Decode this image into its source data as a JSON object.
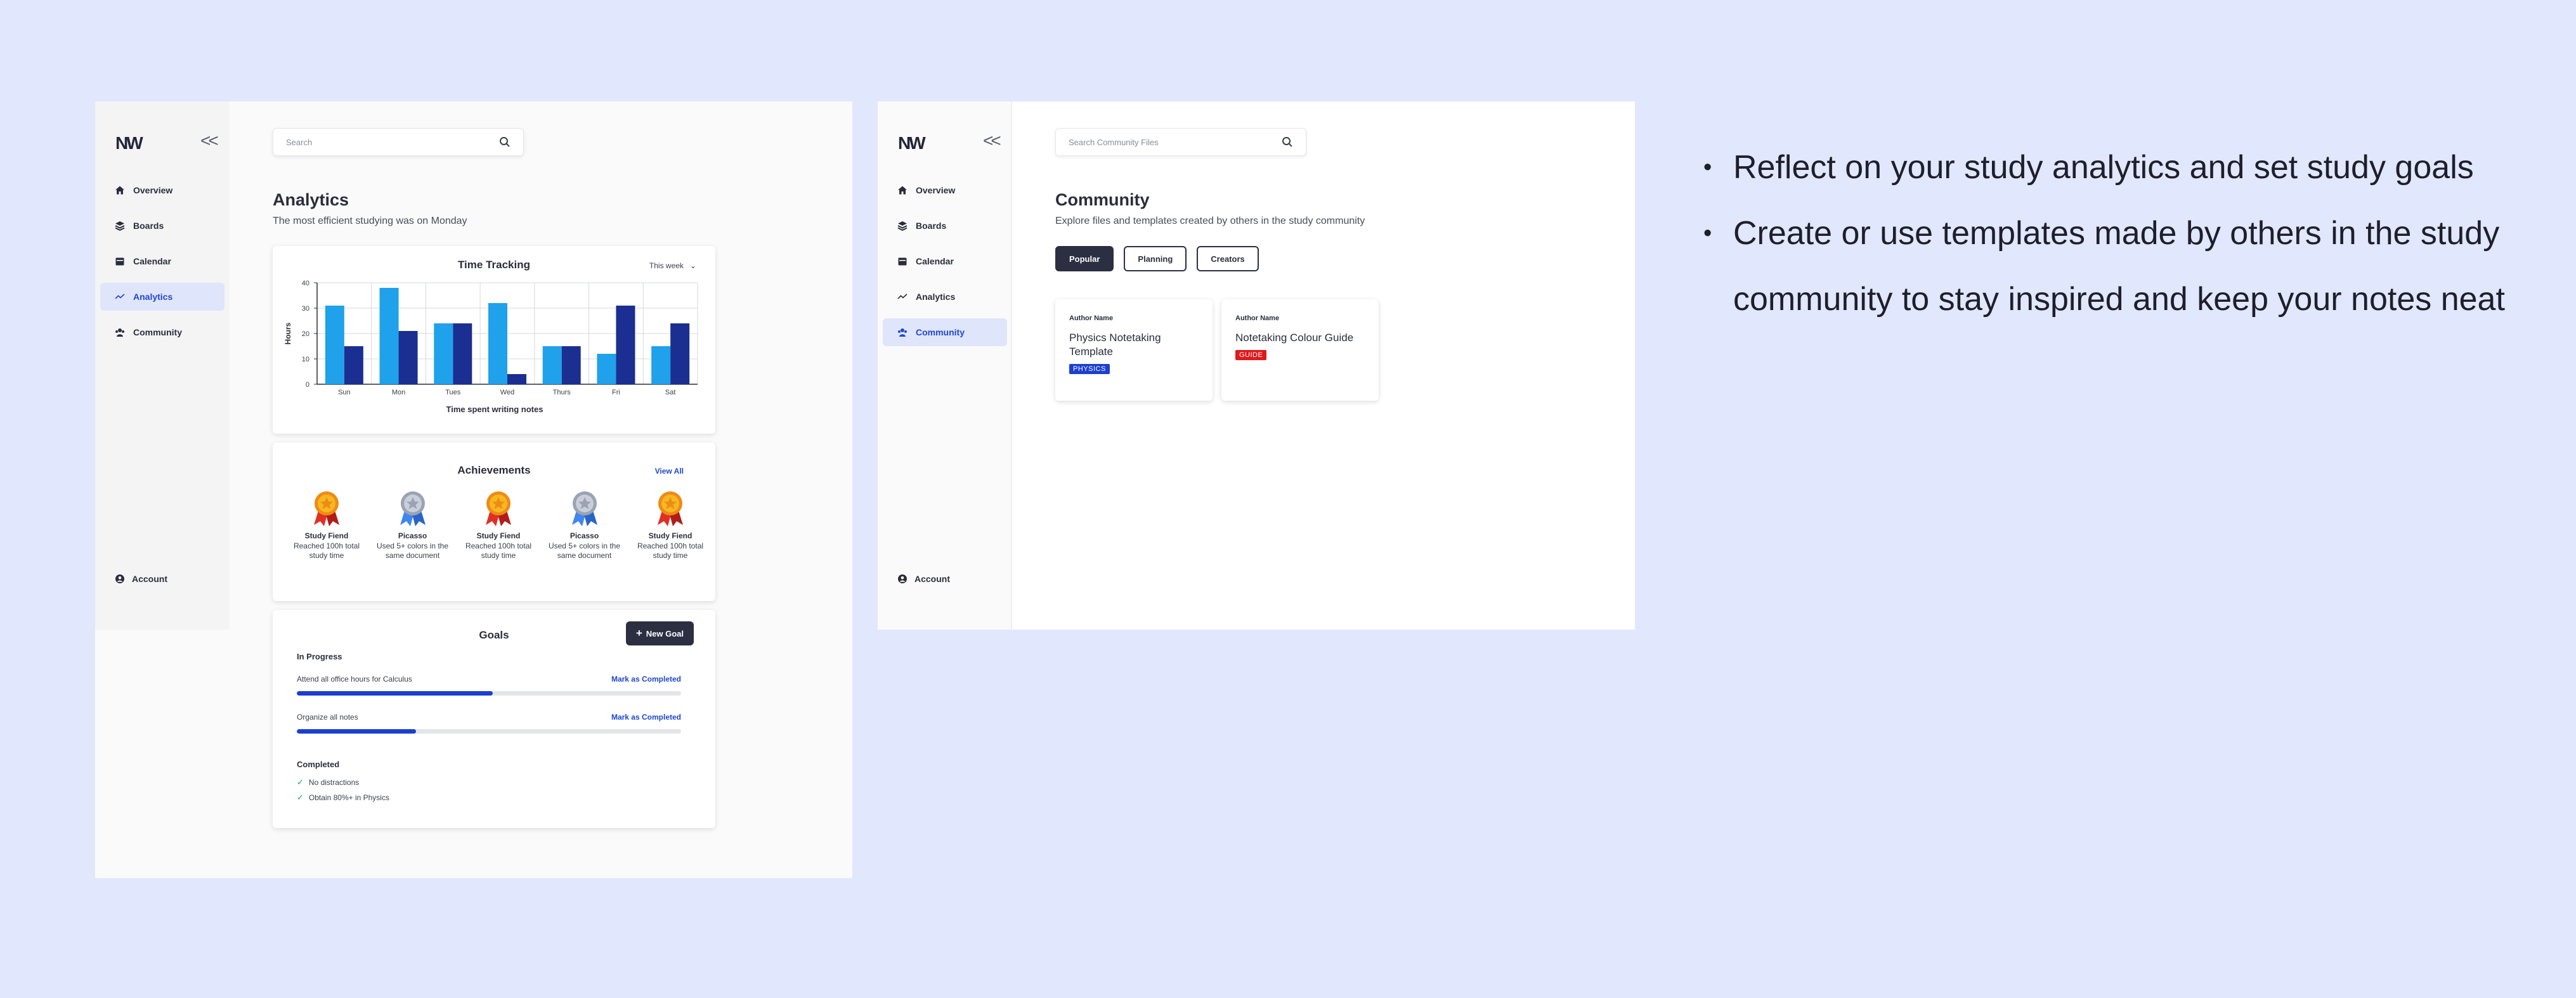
{
  "analytics_panel": {
    "logo": "NW",
    "nav": [
      {
        "label": "Overview",
        "icon": "home-icon"
      },
      {
        "label": "Boards",
        "icon": "layers-icon"
      },
      {
        "label": "Calendar",
        "icon": "calendar-icon"
      },
      {
        "label": "Analytics",
        "icon": "trend-icon",
        "active": true
      },
      {
        "label": "Community",
        "icon": "community-icon"
      }
    ],
    "account_label": "Account",
    "search_placeholder": "Search",
    "title": "Analytics",
    "subtitle": "The most efficient studying was on Monday",
    "time_tracking": {
      "title": "Time Tracking",
      "period": "This week"
    },
    "achievements": {
      "title": "Achievements",
      "view_all": "View All",
      "items": [
        {
          "name": "Study Fiend",
          "desc": "Reached 100h total study time",
          "medal": "gold"
        },
        {
          "name": "Picasso",
          "desc": "Used 5+ colors in the same document",
          "medal": "silver"
        },
        {
          "name": "Study Fiend",
          "desc": "Reached 100h total study time",
          "medal": "gold"
        },
        {
          "name": "Picasso",
          "desc": "Used 5+ colors in the same document",
          "medal": "silver"
        },
        {
          "name": "Study Fiend",
          "desc": "Reached 100h total study time",
          "medal": "gold"
        }
      ]
    },
    "goals": {
      "title": "Goals",
      "new_goal": "New Goal",
      "in_progress_label": "In Progress",
      "in_progress": [
        {
          "label": "Attend all office hours for Calculus",
          "action": "Mark as Completed",
          "progress": 0.51
        },
        {
          "label": "Organize all notes",
          "action": "Mark as Completed",
          "progress": 0.31
        }
      ],
      "completed_label": "Completed",
      "completed": [
        "No distractions",
        "Obtain 80%+ in Physics"
      ]
    }
  },
  "community_panel": {
    "logo": "NW",
    "nav": [
      {
        "label": "Overview",
        "icon": "home-icon"
      },
      {
        "label": "Boards",
        "icon": "layers-icon"
      },
      {
        "label": "Calendar",
        "icon": "calendar-icon"
      },
      {
        "label": "Analytics",
        "icon": "trend-icon"
      },
      {
        "label": "Community",
        "icon": "community-icon",
        "active": true
      }
    ],
    "account_label": "Account",
    "search_placeholder": "Search Community Files",
    "title": "Community",
    "subtitle": "Explore files and templates created by others in the study community",
    "filters": [
      {
        "label": "Popular",
        "active": true
      },
      {
        "label": "Planning",
        "active": false
      },
      {
        "label": "Creators",
        "active": false
      }
    ],
    "files": [
      {
        "author": "Author Name",
        "title": "Physics Notetaking Template",
        "tag": "PHYSICS",
        "tag_color": "#1c3fcf"
      },
      {
        "author": "Author Name",
        "title": "Notetaking Colour Guide",
        "tag": "GUIDE",
        "tag_color": "#e0191b"
      }
    ]
  },
  "bullets": [
    "Reflect on your study analytics and set study goals",
    "Create or use templates made by others in the study community to stay inspired and keep your notes neat"
  ],
  "colors": {
    "background": "#e1e7fc",
    "accent": "#1f47d4",
    "bar_light": "#1fa1eb",
    "bar_dark": "#1b2e91",
    "dark_button": "#2c2f42"
  },
  "chart_data": {
    "type": "bar",
    "title": "Time Tracking",
    "xlabel": "Time spent writing notes",
    "ylabel": "Hours",
    "categories": [
      "Sun",
      "Mon",
      "Tues",
      "Wed",
      "Thurs",
      "Fri",
      "Sat"
    ],
    "series": [
      {
        "values": [
          31,
          38,
          24,
          32,
          15,
          12,
          15
        ]
      },
      {
        "values": [
          15,
          21,
          24,
          4,
          15,
          31,
          24
        ]
      }
    ],
    "yticks": [
      0,
      10,
      20,
      30,
      40
    ],
    "ylim": [
      0,
      40
    ],
    "grid": true
  }
}
